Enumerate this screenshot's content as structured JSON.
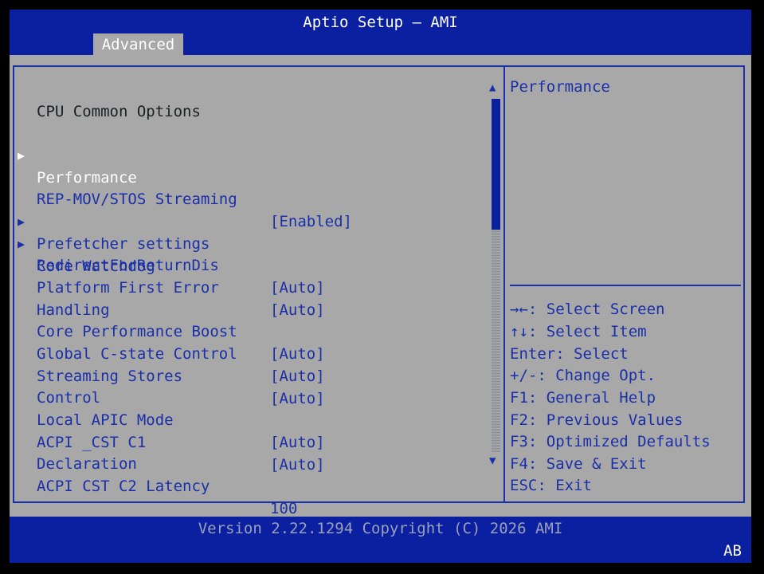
{
  "header": {
    "title": "Aptio Setup – AMI",
    "tab": "Advanced"
  },
  "section_title": "CPU Common Options",
  "items": [
    {
      "label": "Performance",
      "value": "",
      "submenu": true,
      "selected": true
    },
    {
      "label": "REP-MOV/STOS Streaming",
      "value": "[Enabled]",
      "submenu": false
    },
    {
      "label": "Prefetcher settings",
      "value": "",
      "submenu": true
    },
    {
      "label": "Core Watchdog",
      "value": "",
      "submenu": true
    },
    {
      "label": "RedirectForReturnDis",
      "value": "[Auto]",
      "submenu": false
    },
    {
      "label": "Platform First Error",
      "label2": "Handling",
      "value": "[Auto]",
      "submenu": false
    },
    {
      "label": "Core Performance Boost",
      "value": "[Auto]",
      "submenu": false
    },
    {
      "label": "Global C-state Control",
      "value": "[Auto]",
      "submenu": false
    },
    {
      "label": "Streaming Stores",
      "label2": "Control",
      "value": "[Auto]",
      "submenu": false
    },
    {
      "label": "Local APIC Mode",
      "value": "[Auto]",
      "submenu": false
    },
    {
      "label": "ACPI _CST C1",
      "label2": "Declaration",
      "value": "[Auto]",
      "submenu": false
    },
    {
      "label": "ACPI CST C2 Latency",
      "value": "100",
      "submenu": false
    }
  ],
  "help": {
    "title": "Performance",
    "keys": [
      "→←: Select Screen",
      "↑↓: Select Item",
      "Enter: Select",
      "+/-: Change Opt.",
      "F1: General Help",
      "F2: Previous Values",
      "F3: Optimized Defaults",
      "F4: Save & Exit",
      "ESC: Exit"
    ]
  },
  "icons": {
    "submenu": "triangle-right-icon",
    "scroll_up": "triangle-up-icon",
    "scroll_down": "triangle-down-icon"
  },
  "colors": {
    "header_bg": "#0a20a0",
    "panel_bg": "#a8a8a8",
    "text": "#1a2fa8",
    "highlight": "#ffffff"
  },
  "footer": {
    "version": "Version 2.22.1294 Copyright (C) 2026 AMI",
    "badge": "AB"
  }
}
